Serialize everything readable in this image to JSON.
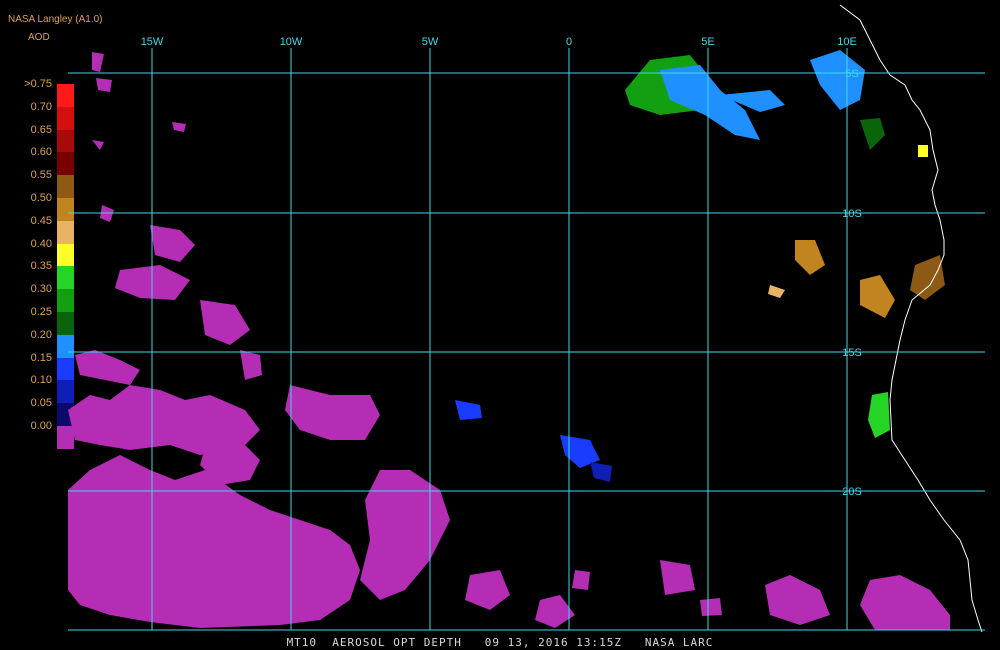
{
  "header": {
    "product": "NASA Langley (A1.0)",
    "parameter": "AOD"
  },
  "legend": {
    "labels": [
      ">0.75",
      "0.70",
      "0.65",
      "0.60",
      "0.55",
      "0.50",
      "0.45",
      "0.40",
      "0.35",
      "0.30",
      "0.25",
      "0.20",
      "0.15",
      "0.10",
      "0.05",
      "0.00"
    ],
    "colors": [
      "#ff1a1a",
      "#d40f0f",
      "#a80a0a",
      "#7a0000",
      "#8c5a14",
      "#c2841e",
      "#e8b464",
      "#ffff28",
      "#26d426",
      "#12a012",
      "#0a640a",
      "#1e90ff",
      "#1a3cff",
      "#0f1eb4",
      "#0a0a6e",
      "#b42db4"
    ]
  },
  "grid": {
    "lon_labels": [
      "15W",
      "10W",
      "5W",
      "0",
      "5E",
      "10E"
    ],
    "lat_labels": [
      "5S",
      "10S",
      "15S",
      "20S"
    ],
    "line_color": "#40d8e8"
  },
  "colors": {
    "background": "#000000",
    "coastline": "#ffffff",
    "low_aod": "#b42db4"
  },
  "footer": {
    "text": "MT10  AEROSOL OPT DEPTH   09 13, 2016 13:15Z   NASA LARC"
  }
}
